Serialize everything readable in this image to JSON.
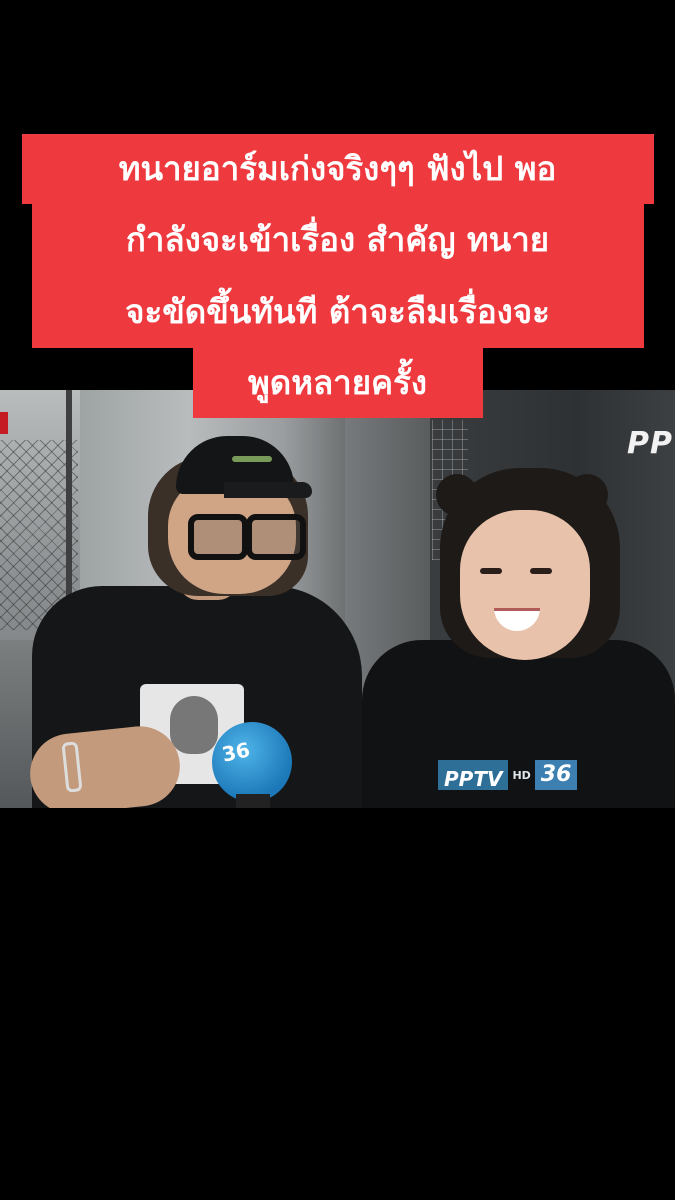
{
  "caption": {
    "lines": [
      "ทนายอาร์มเก่งจริงๆๆ ฟังไป พอ",
      "กำลังจะเข้าเรื่อง สำคัญ ทนาย",
      "จะขัดขึ้นทันที ต้าจะลืมเรื่องจะ",
      "พูดหลายครั้ง"
    ],
    "background_color": "#ee3a3f",
    "text_color": "#ffffff"
  },
  "video": {
    "watermark": "PP",
    "mic_label": "36",
    "shirt_logo": {
      "brand": "PPTV",
      "hd": "HD",
      "channel": "36"
    },
    "accent_color": "#2e6f97"
  }
}
